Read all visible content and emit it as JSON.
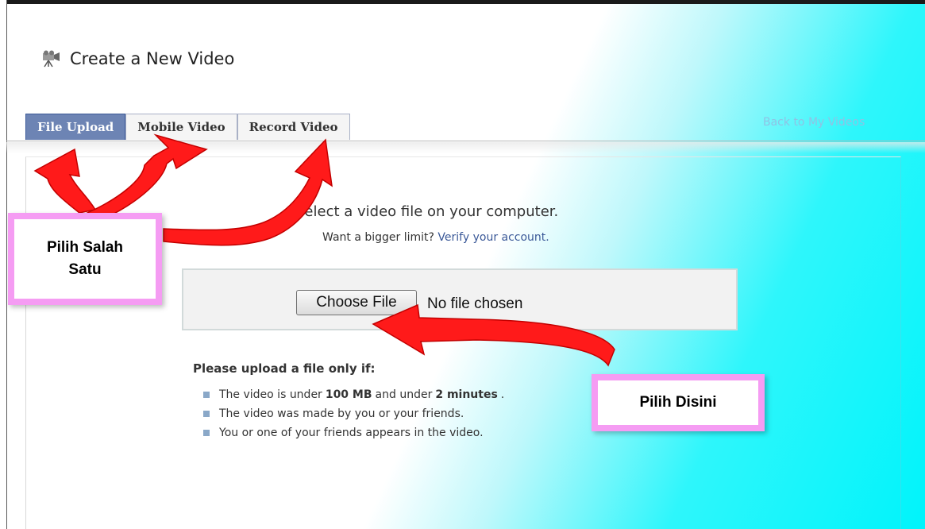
{
  "title": "Create a New Video",
  "tabs": [
    {
      "label": "File Upload",
      "active": true
    },
    {
      "label": "Mobile Video",
      "active": false
    },
    {
      "label": "Record Video",
      "active": false
    }
  ],
  "back_link": "Back to My Videos",
  "upload": {
    "heading": "Select a video file on your computer.",
    "limit_prefix": "Want a bigger limit?",
    "limit_link": "Verify your account.",
    "choose_button": "Choose File",
    "no_file": "No file chosen"
  },
  "requirements": {
    "heading": "Please upload a file only if:",
    "item1": {
      "a": "The video is under",
      "b": "100 MB",
      "c": "and under",
      "d": "2 minutes",
      "e": "."
    },
    "item2": "The video was made by you or your friends.",
    "item3": "You or one of your friends appears in the video."
  },
  "annotations": {
    "callout1_line1": "Pilih Salah",
    "callout1_line2": "Satu",
    "callout2": "Pilih Disini",
    "arrow_color": "#ff1a1a",
    "callout_border_color": "#f59cf3"
  },
  "icons": {
    "title_icon": "video-camera-icon"
  }
}
